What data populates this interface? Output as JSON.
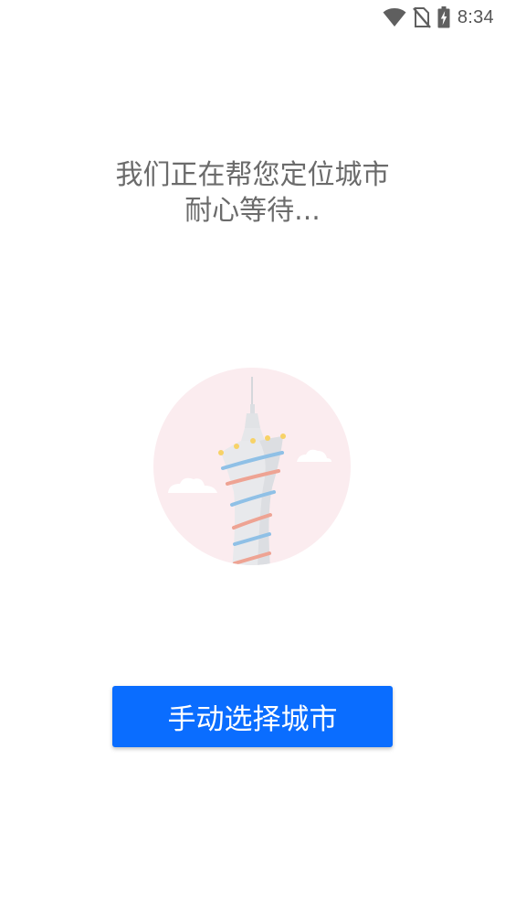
{
  "status_bar": {
    "time": "8:34",
    "icons": [
      "wifi-icon",
      "no-sim-icon",
      "battery-charging-icon"
    ]
  },
  "message": {
    "line1": "我们正在帮您定位城市",
    "line2": "耐心等待..."
  },
  "illustration": {
    "icons": [
      "city-tower-icon",
      "cloud-icon"
    ],
    "colors": {
      "circle": "#fbecef",
      "tower": "#e7e8ea",
      "blue_stripe": "#8fc0e6",
      "red_stripe": "#eea393",
      "lights": "#f7d267"
    }
  },
  "manual_select_button": {
    "label": "手动选择城市",
    "color": "#0a6dff"
  }
}
